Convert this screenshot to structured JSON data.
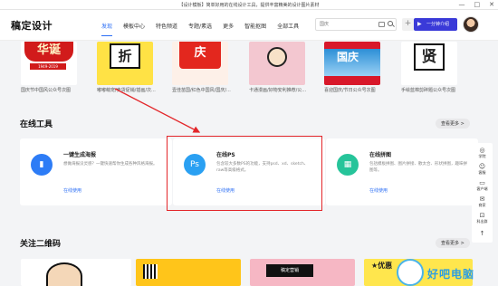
{
  "window": {
    "title": "【设计模板】简单好用的在线设计工具，提供丰富精美的设计图片素材",
    "controls": [
      "—",
      "□",
      "✕"
    ]
  },
  "header": {
    "logo": "稿定设计",
    "nav": [
      "发现",
      "模板中心",
      "特色频道",
      "专题/素选",
      "更多",
      "智能抠图",
      "全部工具"
    ],
    "search_placeholder": "国庆",
    "plus": "+",
    "cta": "一分钟介绍"
  },
  "templates": [
    {
      "art": "华诞",
      "sub": "1949-2019",
      "caption": "国庆节中国风公众号次图"
    },
    {
      "art": "折",
      "caption": "嘟嘟萌宠/卖货促销/插画/次..."
    },
    {
      "art": "庆",
      "caption": "壹佳苗国/红色中国风/国庆/..."
    },
    {
      "art": "",
      "caption": "卡通漫画/好物安利推荐/公..."
    },
    {
      "art": "国庆",
      "caption": "喜迎国庆/节日公众号次图"
    },
    {
      "art": "贤",
      "caption": "手绘蓝棉剪碎题公众号次图"
    }
  ],
  "tools_section": {
    "title": "在线工具",
    "more": "查看更多 >",
    "cards": [
      {
        "icon": "▮",
        "name": "一键生成海报",
        "desc": "想做海报没灵感？一键快速帮你生成各种风格海报。",
        "link": "在线使用"
      },
      {
        "icon": "Ps",
        "name": "在线PS",
        "desc": "包含较大多数PS的功能，支持psd、xd、sketch、raw等高级格式。",
        "link": "在线使用"
      },
      {
        "icon": "▦",
        "name": "在线拼图",
        "desc": "包括模板拼图、图片拼接、歡太合、形状拼图，趣味拼图等。",
        "link": "在线使用"
      }
    ]
  },
  "float_bar": [
    {
      "glyph": "◎",
      "label": "学院"
    },
    {
      "glyph": "☺",
      "label": "客服"
    },
    {
      "glyph": "▭",
      "label": "客户端"
    },
    {
      "glyph": "✉",
      "label": "商家"
    },
    {
      "glyph": "⊡",
      "label": "科出群"
    },
    {
      "glyph": "↑",
      "label": ""
    }
  ],
  "qr_section": {
    "title": "关注二维码",
    "more": "查看更多 >"
  },
  "bottom_cards": [
    {
      "text": ""
    },
    {
      "text": ""
    },
    {
      "text": "稿定营销"
    },
    {
      "text": "★优惠"
    }
  ],
  "watermark": {
    "text": "好吧电脑"
  }
}
